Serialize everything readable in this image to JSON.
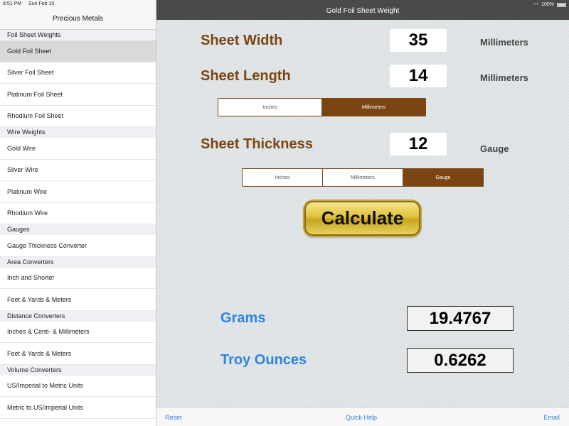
{
  "status": {
    "time": "8:51 PM",
    "date": "Sun Feb 10",
    "battery": "100%"
  },
  "sidebar": {
    "title": "Precious Metals",
    "sections": [
      {
        "header": "Foil Sheet Weights",
        "items": [
          "Gold Foil Sheet",
          "Silver Foil Sheet",
          "Platinum Foil Sheet",
          "Rhodium Foil Sheet"
        ]
      },
      {
        "header": "Wire Weights",
        "items": [
          "Gold Wire",
          "Silver Wire",
          "Platinum Wire",
          "Rhodium Wire"
        ]
      },
      {
        "header": "Gauges",
        "items": [
          "Gauge Thickness Converter"
        ]
      },
      {
        "header": "Area Converters",
        "items": [
          "Inch and Shorter",
          "Feet & Yards & Meters"
        ]
      },
      {
        "header": "Distance Converters",
        "items": [
          "Inches & Centi- & Millimeters",
          "Feet & Yards & Meters"
        ]
      },
      {
        "header": "Volume Converters",
        "items": [
          "US/Imperial to Metric Units",
          "Metric to US/Imperial Units"
        ]
      }
    ],
    "selected": "Gold Foil Sheet"
  },
  "nav": {
    "title": "Gold Foil Sheet Weight"
  },
  "form": {
    "width_label": "Sheet Width",
    "width_value": "35",
    "width_unit": "Millimeters",
    "length_label": "Sheet Length",
    "length_value": "14",
    "length_unit": "Millimeters",
    "length_segments": [
      "Inches",
      "Millimeters"
    ],
    "length_segment_selected": 1,
    "thickness_label": "Sheet Thickness",
    "thickness_value": "12",
    "thickness_unit": "Gauge",
    "thickness_segments": [
      "Inches",
      "Millimeters",
      "Gauge"
    ],
    "thickness_segment_selected": 2,
    "calculate_label": "Calculate"
  },
  "results": {
    "grams_label": "Grams",
    "grams_value": "19.4767",
    "troy_label": "Troy Ounces",
    "troy_value": "0.6262"
  },
  "bottom": {
    "reset": "Reset",
    "quick_help": "Quick Help",
    "email": "Email"
  },
  "colors": {
    "accent_brown": "#7b4513",
    "link_blue": "#2f84e0",
    "nav_dark": "#4a4a4a"
  }
}
